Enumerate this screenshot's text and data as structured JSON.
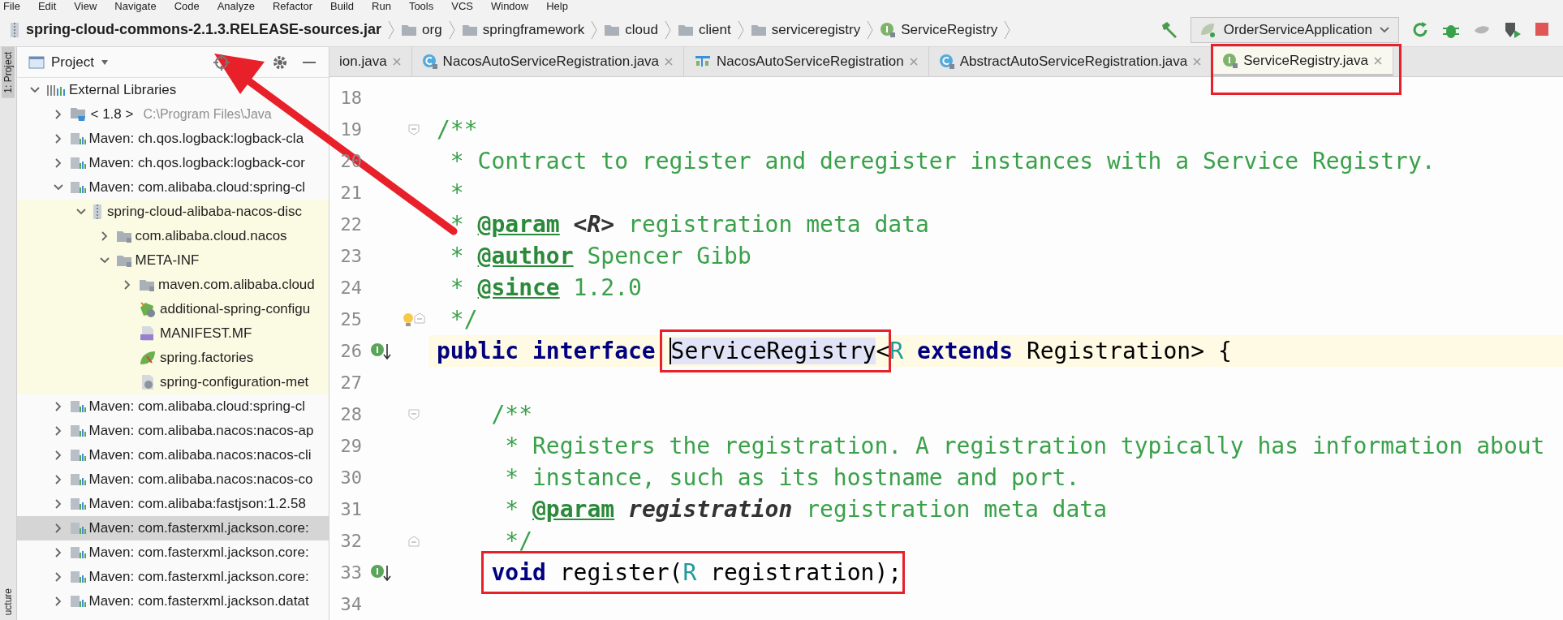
{
  "menu_bar": [
    "File",
    "Edit",
    "View",
    "Navigate",
    "Code",
    "Analyze",
    "Refactor",
    "Build",
    "Run",
    "Tools",
    "VCS",
    "Window",
    "Help"
  ],
  "breadcrumbs": [
    {
      "label": "spring-cloud-commons-2.1.3.RELEASE-sources.jar",
      "kind": "jar"
    },
    {
      "label": "org",
      "kind": "folder"
    },
    {
      "label": "springframework",
      "kind": "folder"
    },
    {
      "label": "cloud",
      "kind": "folder"
    },
    {
      "label": "client",
      "kind": "folder"
    },
    {
      "label": "serviceregistry",
      "kind": "folder"
    },
    {
      "label": "ServiceRegistry",
      "kind": "interface"
    }
  ],
  "run_configuration": {
    "label": "OrderServiceApplication"
  },
  "tool_strip": {
    "top_label": "1: Project",
    "bottom_label": "ucture"
  },
  "project_panel": {
    "title": "Project",
    "tree": [
      {
        "label": "External Libraries",
        "kind": "libraries",
        "expanded": true,
        "selected": false,
        "children": [
          {
            "label": "< 1.8 >",
            "hint": "C:\\Program Files\\Java",
            "kind": "sdk",
            "expanded": false,
            "selected": false
          },
          {
            "label": "Maven: ch.qos.logback:logback-cla",
            "kind": "maven",
            "expanded": false,
            "selected": false
          },
          {
            "label": "Maven: ch.qos.logback:logback-cor",
            "kind": "maven",
            "expanded": false,
            "selected": false
          },
          {
            "label": "Maven: com.alibaba.cloud:spring-cl",
            "kind": "maven",
            "expanded": true,
            "selected": false,
            "children": [
              {
                "label": "spring-cloud-alibaba-nacos-disc",
                "kind": "jar",
                "expanded": true,
                "selected": false,
                "library_source": true,
                "children": [
                  {
                    "label": "com.alibaba.cloud.nacos",
                    "kind": "package",
                    "expanded": false,
                    "selected": false
                  },
                  {
                    "label": "META-INF",
                    "kind": "package",
                    "expanded": true,
                    "selected": false,
                    "children": [
                      {
                        "label": "maven.com.alibaba.cloud",
                        "kind": "package",
                        "expanded": false,
                        "selected": false
                      },
                      {
                        "label": "additional-spring-configu",
                        "kind": "spring-json",
                        "selected": false
                      },
                      {
                        "label": "MANIFEST.MF",
                        "kind": "manifest",
                        "selected": false
                      },
                      {
                        "label": "spring.factories",
                        "kind": "spring",
                        "selected": false
                      },
                      {
                        "label": "spring-configuration-met",
                        "kind": "config",
                        "selected": false
                      }
                    ]
                  }
                ]
              }
            ]
          },
          {
            "label": "Maven: com.alibaba.cloud:spring-cl",
            "kind": "maven",
            "expanded": false,
            "selected": false
          },
          {
            "label": "Maven: com.alibaba.nacos:nacos-ap",
            "kind": "maven",
            "expanded": false,
            "selected": false
          },
          {
            "label": "Maven: com.alibaba.nacos:nacos-cli",
            "kind": "maven",
            "expanded": false,
            "selected": false
          },
          {
            "label": "Maven: com.alibaba.nacos:nacos-co",
            "kind": "maven",
            "expanded": false,
            "selected": false
          },
          {
            "label": "Maven: com.alibaba:fastjson:1.2.58",
            "kind": "maven",
            "expanded": false,
            "selected": false
          },
          {
            "label": "Maven: com.fasterxml.jackson.core:",
            "kind": "maven",
            "expanded": false,
            "selected": true
          },
          {
            "label": "Maven: com.fasterxml.jackson.core:",
            "kind": "maven",
            "expanded": false,
            "selected": false
          },
          {
            "label": "Maven: com.fasterxml.jackson.core:",
            "kind": "maven",
            "expanded": false,
            "selected": false
          },
          {
            "label": "Maven: com.fasterxml.jackson.datat",
            "kind": "maven",
            "expanded": false,
            "selected": false
          }
        ]
      }
    ]
  },
  "tabs": [
    {
      "label": "ion.java",
      "selected": false,
      "boxed": false
    },
    {
      "label": "NacosAutoServiceRegistration.java",
      "kind": "class",
      "selected": false,
      "boxed": false
    },
    {
      "label": "NacosAutoServiceRegistration",
      "kind": "structure",
      "selected": false,
      "boxed": false
    },
    {
      "label": "AbstractAutoServiceRegistration.java",
      "kind": "class",
      "selected": false,
      "boxed": false
    },
    {
      "label": "ServiceRegistry.java",
      "kind": "interface",
      "selected": true,
      "boxed": true
    }
  ],
  "editor": {
    "lines": [
      {
        "n": "18",
        "current": false
      },
      {
        "n": "19",
        "current": false,
        "fold_start": true,
        "tokens": [
          {
            "kind": "doc",
            "text": "/**"
          }
        ]
      },
      {
        "n": "20",
        "current": false,
        "tokens": [
          {
            "kind": "doc",
            "text": " * Contract to register and deregister instances with a Service Registry."
          }
        ]
      },
      {
        "n": "21",
        "current": false,
        "tokens": [
          {
            "kind": "doc",
            "text": " *"
          }
        ]
      },
      {
        "n": "22",
        "current": false,
        "tokens": [
          {
            "kind": "doc",
            "text": " * "
          },
          {
            "kind": "tag",
            "text": "@param"
          },
          {
            "kind": "ref",
            "text": " <R>"
          },
          {
            "kind": "doc",
            "text": " registration meta data"
          }
        ]
      },
      {
        "n": "23",
        "current": false,
        "tokens": [
          {
            "kind": "doc",
            "text": " * "
          },
          {
            "kind": "tag",
            "text": "@author"
          },
          {
            "kind": "doc",
            "text": " Spencer Gibb"
          }
        ]
      },
      {
        "n": "24",
        "current": false,
        "tokens": [
          {
            "kind": "doc",
            "text": " * "
          },
          {
            "kind": "tag",
            "text": "@since"
          },
          {
            "kind": "doc",
            "text": " 1.2.0"
          }
        ]
      },
      {
        "n": "25",
        "current": false,
        "bulb": true,
        "fold_end": true,
        "tokens": [
          {
            "kind": "doc",
            "text": " */"
          }
        ]
      },
      {
        "n": "26",
        "current": true,
        "implemented": true,
        "tokens": [
          {
            "kind": "kw",
            "text": "public interface "
          },
          {
            "kind": "group",
            "boxed": true,
            "tokens": [
              {
                "kind": "plain",
                "text": "ServiceRegistry",
                "highlighted": true
              },
              {
                "kind": "plain",
                "text": "<"
              }
            ]
          },
          {
            "kind": "tparam",
            "text": "R"
          },
          {
            "kind": "kw",
            "text": " extends"
          },
          {
            "kind": "plain",
            "text": " Registration> {"
          }
        ]
      },
      {
        "n": "27",
        "current": false
      },
      {
        "n": "28",
        "current": false,
        "fold_start": true,
        "tokens": [
          {
            "kind": "doc",
            "text": "    /**"
          }
        ]
      },
      {
        "n": "29",
        "current": false,
        "tokens": [
          {
            "kind": "doc",
            "text": "     * Registers the registration. A registration typically has information about"
          }
        ]
      },
      {
        "n": "30",
        "current": false,
        "tokens": [
          {
            "kind": "doc",
            "text": "     * instance, such as its hostname and port."
          }
        ]
      },
      {
        "n": "31",
        "current": false,
        "tokens": [
          {
            "kind": "doc",
            "text": "     * "
          },
          {
            "kind": "tag",
            "text": "@param"
          },
          {
            "kind": "ref",
            "text": " registration"
          },
          {
            "kind": "doc",
            "text": " registration meta data"
          }
        ]
      },
      {
        "n": "32",
        "current": false,
        "fold_end": true,
        "tokens": [
          {
            "kind": "doc",
            "text": "     */"
          }
        ]
      },
      {
        "n": "33",
        "current": false,
        "implemented": true,
        "tokens": [
          {
            "kind": "group",
            "boxed": true,
            "tokens": [
              {
                "kind": "kw",
                "text": "    void"
              },
              {
                "kind": "plain",
                "text": " register("
              },
              {
                "kind": "tparam",
                "text": "R"
              },
              {
                "kind": "plain",
                "text": " registration);"
              }
            ]
          }
        ]
      },
      {
        "n": "34",
        "current": false
      }
    ]
  },
  "annotations": {
    "arrow": true
  }
}
